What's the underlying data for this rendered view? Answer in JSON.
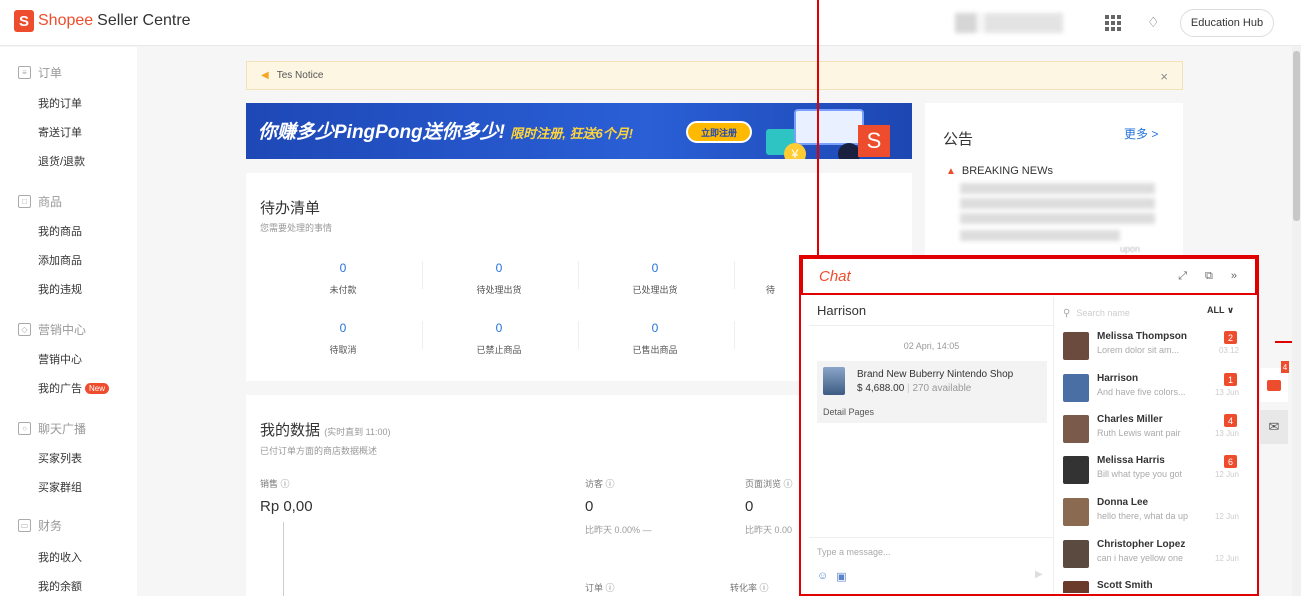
{
  "header": {
    "logo_glyph": "S",
    "brand": "Shopee",
    "product": "Seller Centre",
    "edu_hub": "Education Hub"
  },
  "sidebar": {
    "groups": [
      {
        "label": "订单",
        "icon": "document-icon",
        "items": [
          "我的订单",
          "寄送订单",
          "退货/退款"
        ]
      },
      {
        "label": "商品",
        "icon": "product-icon",
        "items": [
          "我的商品",
          "添加商品",
          "我的违规"
        ]
      },
      {
        "label": "营销中心",
        "icon": "tag-icon",
        "items": [
          "营销中心",
          "我的广告"
        ]
      },
      {
        "label": "聊天广播",
        "icon": "user-icon",
        "items": [
          "买家列表",
          "买家群组"
        ]
      },
      {
        "label": "财务",
        "icon": "wallet-icon",
        "items": [
          "我的收入",
          "我的余额"
        ]
      }
    ],
    "new_badge": "New"
  },
  "notice": {
    "text": "Tes Notice",
    "close": "×"
  },
  "banner": {
    "headline": "你赚多少PingPong送你多少!",
    "promo": "限时注册, 狂送6个月!",
    "cta": "立即注册",
    "coin": "¥",
    "tile": "S"
  },
  "todo": {
    "title": "待办清单",
    "subtitle": "您需要处理的事情",
    "items": [
      {
        "value": "0",
        "label": "未付款"
      },
      {
        "value": "0",
        "label": "待处理出货"
      },
      {
        "value": "0",
        "label": "已处理出货"
      },
      {
        "value": "0",
        "label": "待"
      },
      {
        "value": "0",
        "label": "待取消"
      },
      {
        "value": "0",
        "label": "已禁止商品"
      },
      {
        "value": "0",
        "label": "已售出商品"
      }
    ]
  },
  "announcement": {
    "title": "公告",
    "more": "更多 >",
    "news": "BREAKING NEWs",
    "blurred_tail": "upon"
  },
  "mydata": {
    "title": "我的数据",
    "realtime": "(实时直到 11:00)",
    "subtitle": "已付订单方面的商店数据概述",
    "sales_label": "销售",
    "sales_value": "Rp 0,00",
    "visits_label": "访客",
    "visits_value": "0",
    "visits_cmp": "比昨天 0.00% —",
    "pageviews_label": "页面浏览",
    "pageviews_value": "0",
    "pageviews_cmp": "比昨天 0.00",
    "orders_label": "订单",
    "conv_label": "转化率"
  },
  "chat": {
    "title": "Chat",
    "contact": "Harrison",
    "date": "02 Apri, 14:05",
    "product": {
      "name": "Brand New Buberry Nintendo Shop",
      "price": "$ 4,688.00",
      "available": "270 available",
      "link": "Detail Pages"
    },
    "input_placeholder": "Type a message...",
    "search_placeholder": "Search name",
    "filter": "ALL",
    "conversations": [
      {
        "name": "Melissa Thompson",
        "preview": "Lorem dolor sit am...",
        "date": "03.12",
        "badge": "2",
        "color": "#6b4b3e"
      },
      {
        "name": "Harrison",
        "preview": "And have five colors...",
        "date": "13 Jun",
        "badge": "1",
        "color": "#4a6fa5"
      },
      {
        "name": "Charles Miller",
        "preview": "Ruth Lewis want pair",
        "date": "13 Jun",
        "badge": "4",
        "color": "#7a5a4a"
      },
      {
        "name": "Melissa Harris",
        "preview": "Bill what type you got",
        "date": "12 Jun",
        "badge": "6",
        "color": "#333333"
      },
      {
        "name": "Donna Lee",
        "preview": "hello there, what da up",
        "date": "12 Jun",
        "badge": "",
        "color": "#8a6a50"
      },
      {
        "name": "Christopher Lopez",
        "preview": "can i have yellow one",
        "date": "12 Jun",
        "badge": "",
        "color": "#5a4a40"
      },
      {
        "name": "Scott Smith",
        "preview": "",
        "date": "",
        "badge": "",
        "color": "#6a3a2a"
      }
    ]
  },
  "floating": {
    "chat_badge": "4"
  }
}
